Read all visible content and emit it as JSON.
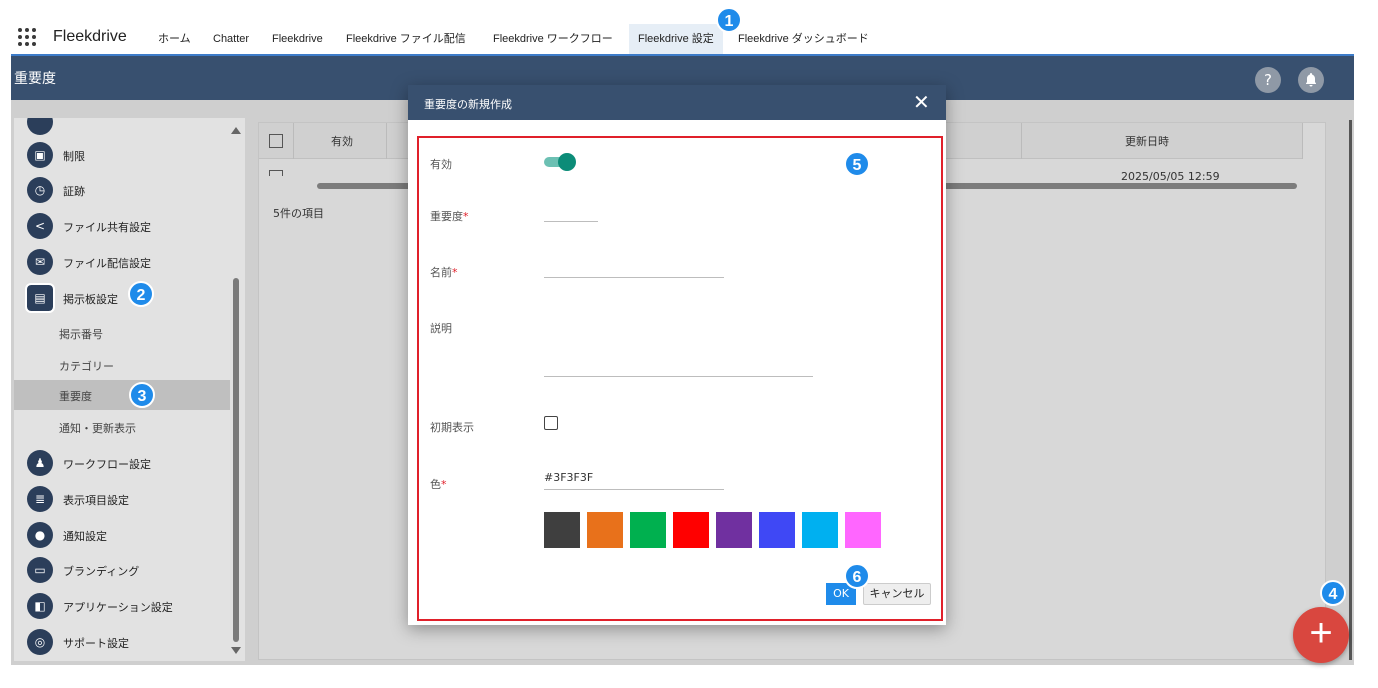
{
  "topnav": {
    "app_name": "Fleekdrive",
    "tabs": [
      {
        "label": "ホーム"
      },
      {
        "label": "Chatter"
      },
      {
        "label": "Fleekdrive"
      },
      {
        "label": "Fleekdrive ファイル配信"
      },
      {
        "label": "Fleekdrive ワークフロー"
      },
      {
        "label": "Fleekdrive 設定"
      },
      {
        "label": "Fleekdrive ダッシュボード"
      }
    ],
    "active_tab": "Fleekdrive 設定"
  },
  "header": {
    "title": "重要度",
    "help_icon": "?",
    "bell_icon": "bell-icon"
  },
  "sidebar": {
    "items": [
      {
        "label": "制限",
        "icon": "camera-icon"
      },
      {
        "label": "証跡",
        "icon": "history-icon"
      },
      {
        "label": "ファイル共有設定",
        "icon": "share-icon"
      },
      {
        "label": "ファイル配信設定",
        "icon": "mail-icon"
      },
      {
        "label": "掲示板設定",
        "icon": "board-icon"
      }
    ],
    "subitems": [
      {
        "label": "掲示番号"
      },
      {
        "label": "カテゴリー"
      },
      {
        "label": "重要度"
      },
      {
        "label": "通知・更新表示"
      }
    ],
    "items_after": [
      {
        "label": "ワークフロー設定",
        "icon": "stamp-icon"
      },
      {
        "label": "表示項目設定",
        "icon": "list-icon"
      },
      {
        "label": "通知設定",
        "icon": "bell-icon"
      },
      {
        "label": "ブランディング",
        "icon": "branding-icon"
      },
      {
        "label": "アプリケーション設定",
        "icon": "app-icon"
      },
      {
        "label": "サポート設定",
        "icon": "support-icon"
      }
    ],
    "selected_subitem": "重要度"
  },
  "table": {
    "columns": [
      "有効",
      "更新日時"
    ],
    "row_date": "2025/05/05 12:59",
    "count_text": "5件の項目"
  },
  "modal": {
    "title": "重要度の新規作成",
    "close": "✕",
    "fields": {
      "enabled_label": "有効",
      "importance_label": "重要度",
      "name_label": "名前",
      "description_label": "説明",
      "initial_display_label": "初期表示",
      "color_label": "色",
      "color_value": "#3F3F3F"
    },
    "swatches": [
      "#3F3F3F",
      "#E8711B",
      "#00B04F",
      "#FF0000",
      "#7030A0",
      "#3F48F5",
      "#00B0F0",
      "#FF66FF"
    ],
    "ok_label": "OK",
    "cancel_label": "キャンセル"
  },
  "badges": [
    "1",
    "2",
    "3",
    "4",
    "5",
    "6"
  ],
  "colors": {
    "header_bg": "#38506F",
    "accent_blue": "#1F8BEA",
    "fab_red": "#D9473F",
    "highlight_red": "#E0202A",
    "toggle_green": "#0C8C78"
  }
}
